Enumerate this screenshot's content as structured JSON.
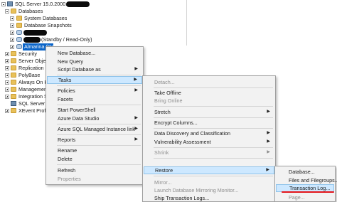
{
  "tree": {
    "server_label": "SQL Server 15.0.2000.5",
    "databases": "Databases",
    "system_databases": "System Databases",
    "database_snapshots": "Database Snapshots",
    "standby_suffix": "(Standby / Read-Only)",
    "restoring_db": "Almarina (Restoring...)",
    "security": "Security",
    "server_objects": "Server Obje",
    "replication": "Replication",
    "polybase": "PolyBase",
    "always_on": "Always On Hi",
    "management": "Management",
    "integration": "Integration Se",
    "sql_agent": "SQL Server Ag",
    "xevent": "XEvent Profile"
  },
  "menu1": {
    "items": [
      {
        "label": "New Database...",
        "disabled": false
      },
      {
        "label": "New Query",
        "disabled": false
      },
      {
        "label": "Script Database as",
        "disabled": false,
        "submenu": true
      },
      {
        "label": "Tasks",
        "disabled": false,
        "submenu": true
      },
      {
        "label": "Policies",
        "disabled": false,
        "submenu": true
      },
      {
        "label": "Facets",
        "disabled": false
      },
      {
        "label": "Start PowerShell",
        "disabled": false
      },
      {
        "label": "Azure Data Studio",
        "disabled": false,
        "submenu": true
      },
      {
        "label": "Azure SQL Managed Instance link",
        "disabled": false,
        "submenu": true
      },
      {
        "label": "Reports",
        "disabled": false,
        "submenu": true
      },
      {
        "label": "Rename",
        "disabled": false
      },
      {
        "label": "Delete",
        "disabled": false
      },
      {
        "label": "Refresh",
        "disabled": false
      },
      {
        "label": "Properties",
        "disabled": true
      }
    ]
  },
  "menu2": {
    "items": [
      {
        "label": "Detach...",
        "disabled": true
      },
      {
        "label": "Take Offline",
        "disabled": false
      },
      {
        "label": "Bring Online",
        "disabled": true
      },
      {
        "label": "Stretch",
        "disabled": false,
        "submenu": true
      },
      {
        "label": "Encrypt Columns...",
        "disabled": false
      },
      {
        "label": "Data Discovery and Classification",
        "disabled": false,
        "submenu": true
      },
      {
        "label": "Vulnerability Assessment",
        "disabled": false,
        "submenu": true
      },
      {
        "label": "Shrink",
        "disabled": true,
        "submenu": true
      },
      {
        "label": "Restore",
        "disabled": false,
        "submenu": true
      },
      {
        "label": "Mirror...",
        "disabled": true
      },
      {
        "label": "Launch Database Mirroring Monitor...",
        "disabled": true
      },
      {
        "label": "Ship Transaction Logs...",
        "disabled": false
      }
    ]
  },
  "menu3": {
    "items": [
      {
        "label": "Database...",
        "disabled": false
      },
      {
        "label": "Files and Filegroups...",
        "disabled": false
      },
      {
        "label": "Transaction Log...",
        "disabled": false
      },
      {
        "label": "Page...",
        "disabled": true
      }
    ]
  },
  "colors": {
    "selection": "#0a64c8",
    "hover": "#cde8ff",
    "annotation": "#e4141a"
  }
}
